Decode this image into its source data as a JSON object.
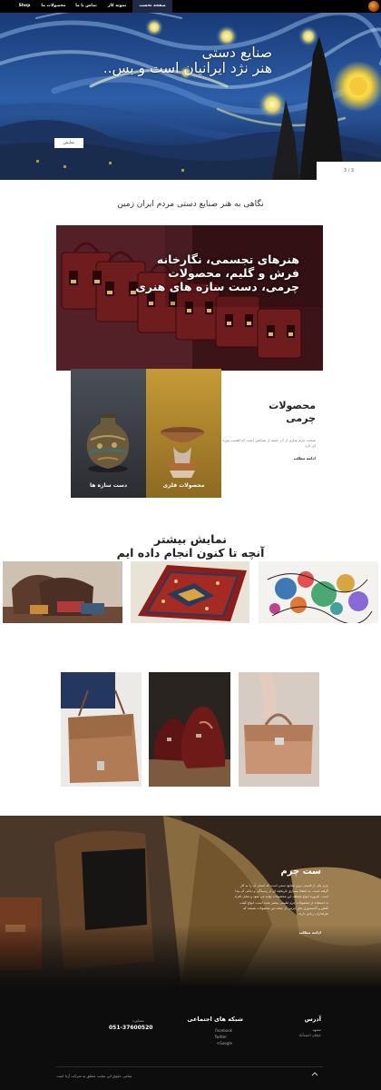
{
  "nav": {
    "items": [
      {
        "label": "صفحه نخست",
        "active": true
      },
      {
        "label": "نمونه کار",
        "active": false
      },
      {
        "label": "تماس با ما",
        "active": false
      },
      {
        "label": "محصولات ما",
        "active": false
      },
      {
        "label": "Shop",
        "active": false
      }
    ],
    "logo_icon": "brand-logo-icon"
  },
  "hero": {
    "title_line1": "صنایع دستی",
    "title_line2": "هنر نژد ایرانیان است و بس..",
    "button_label": "نمایش",
    "slide_counter": "3 / 3"
  },
  "intro": {
    "title": "نگاهی به هنر صنایع دستی مردم ایران زمین"
  },
  "banner": {
    "line1": "هنرهای تجسمی، نگارخانه",
    "line2": "فرش و گلیم، محصولات",
    "line3": "چرمی، دست سازه های هنری"
  },
  "tiles": {
    "handmade_label": "دست سازه ها",
    "metal_label": "محصولات فلزی"
  },
  "products": {
    "title_line1": "محصولات",
    "title_line2": "چرمی",
    "description": "صنعت چرم سازی از آن دسته از صنایعی است که اهمیت ویژه ای دارد",
    "more_label": "ادامه مطلب"
  },
  "gallery": {
    "title_line1": "نمایش بیشتر",
    "title_line2": "آنچه تا کنون انجام داده ایم"
  },
  "leather_set": {
    "title": "ست چرم",
    "description": "چرم یکی از قدیمی ترین صنایع دستی است که انسان آن را به کار گرفته است. به اعتقاد بسیاری تاریخچه ای از رسیدگی و دباغی آن پیدا است. امروزه انواع مختلف این محصولات تولید می شود و تمایل افراد به استفاده از محصولات چرم طبیعی بیشتر شده است. انواع کیف، کفش و اکسسوری های چرمی از جمله این محصولات هستند که طرفداران زیادی دارند.",
    "more_label": "ادامه مطلب"
  },
  "footer": {
    "address_title": "آدرس",
    "address_line1": "مشهد",
    "address_line2": "خیابان احمدآباد",
    "social_title": "شبکه های اجتماعی",
    "social_items": [
      "Facebook",
      "Twitter",
      "+Google"
    ],
    "phone_title": "مشاوره",
    "phone": "051-37600520",
    "copyright": "تمامی حقوق این سایت متعلق به شرکت آرتا است",
    "to_top_icon": "chevron-up-icon"
  },
  "colors": {
    "nav_bg": "#000000",
    "nav_active": "#1f2a44",
    "banner_bg": "#3a1418",
    "footer_bg": "#0d0d0d"
  }
}
